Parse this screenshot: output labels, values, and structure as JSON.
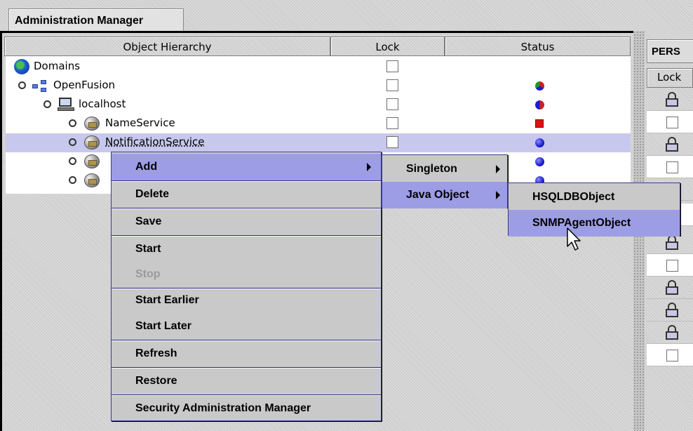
{
  "window": {
    "tab_title": "Administration Manager"
  },
  "tree": {
    "columns": [
      "Object Hierarchy",
      "Lock",
      "Status"
    ],
    "rows": [
      {
        "label": "Domains",
        "status": "none"
      },
      {
        "label": "OpenFusion",
        "status": "mixed"
      },
      {
        "label": "localhost",
        "status": "red-blue"
      },
      {
        "label": "NameService",
        "status": "stopped"
      },
      {
        "label": "NotificationService",
        "status": "running",
        "selected": true
      }
    ]
  },
  "right_panel": {
    "tab_label": "PERS",
    "column_header": "Lock"
  },
  "context_menu": {
    "items": [
      "Add",
      "Delete",
      "Save",
      "Start",
      "Stop",
      "Start Earlier",
      "Start Later",
      "Refresh",
      "Restore",
      "Security Administration Manager"
    ],
    "highlighted": "Add",
    "disabled": [
      "Stop"
    ]
  },
  "add_submenu": {
    "items": [
      "Singleton",
      "Java Object"
    ],
    "highlighted": "Java Object"
  },
  "java_object_submenu": {
    "items": [
      "HSQLDBObject",
      "SNMPAgentObject"
    ],
    "highlighted": "SNMPAgentObject"
  },
  "colors": {
    "selection": "#c8c8ee",
    "menu_highlight": "#9d9de6",
    "menu_border": "#3b3b8a"
  }
}
